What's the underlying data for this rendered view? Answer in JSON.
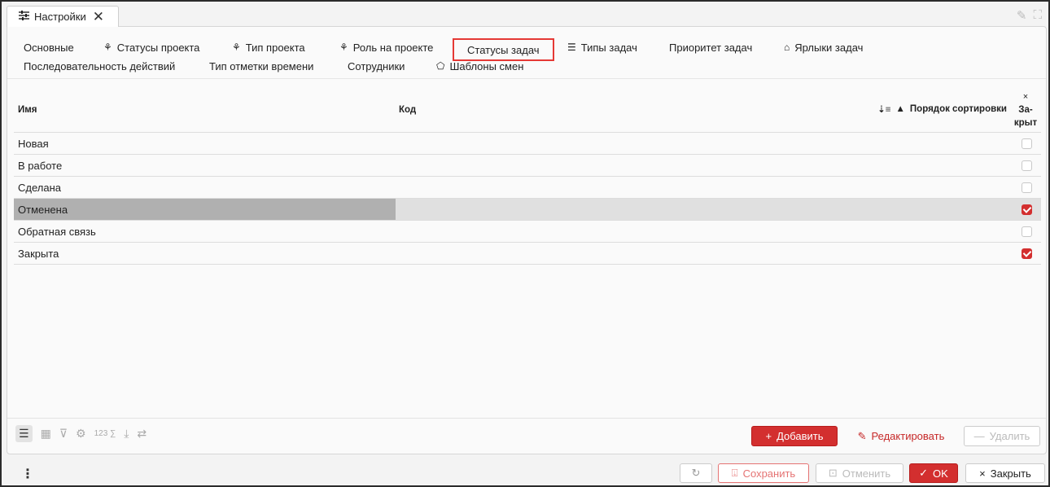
{
  "window": {
    "tab_title": "Настройки"
  },
  "tabs": [
    {
      "label": "Основные",
      "icon": ""
    },
    {
      "label": "Статусы проекта",
      "icon": "hierarchy-icon"
    },
    {
      "label": "Тип проекта",
      "icon": "hierarchy-icon"
    },
    {
      "label": "Роль на проекте",
      "icon": "hierarchy-icon"
    },
    {
      "label": "Статусы задач",
      "icon": "",
      "active": true
    },
    {
      "label": "Типы задач",
      "icon": "list-icon"
    },
    {
      "label": "Приоритет задач",
      "icon": ""
    },
    {
      "label": "Ярлыки задач",
      "icon": "tag-icon"
    },
    {
      "label": "Последовательность действий",
      "icon": ""
    },
    {
      "label": "Тип отметки времени",
      "icon": ""
    },
    {
      "label": "Сотрудники",
      "icon": ""
    },
    {
      "label": "Шаблоны смен",
      "icon": "shapes-icon"
    }
  ],
  "table": {
    "columns": {
      "name": "Имя",
      "code": "Код",
      "sort": "Порядок сортировки",
      "closed_x": "×",
      "closed": "За-\nкрыт"
    },
    "rows": [
      {
        "name": "Новая",
        "closed": false
      },
      {
        "name": "В работе",
        "closed": false
      },
      {
        "name": "Сделана",
        "closed": false
      },
      {
        "name": "Отменена",
        "closed": true,
        "selected": true
      },
      {
        "name": "Обратная связь",
        "closed": false
      },
      {
        "name": "Закрыта",
        "closed": true
      }
    ]
  },
  "toolbar": {
    "add_label": "Добавить",
    "edit_label": "Редактировать",
    "delete_label": "Удалить",
    "sum_label": "123"
  },
  "footer": {
    "save_label": "Сохранить",
    "cancel_label": "Отменить",
    "ok_label": "OK",
    "close_label": "Закрыть"
  },
  "colors": {
    "accent": "#d32f2f",
    "highlight": "#e53935",
    "selected_row": "#e0e0e0",
    "selected_cell": "#b0b0b0"
  }
}
